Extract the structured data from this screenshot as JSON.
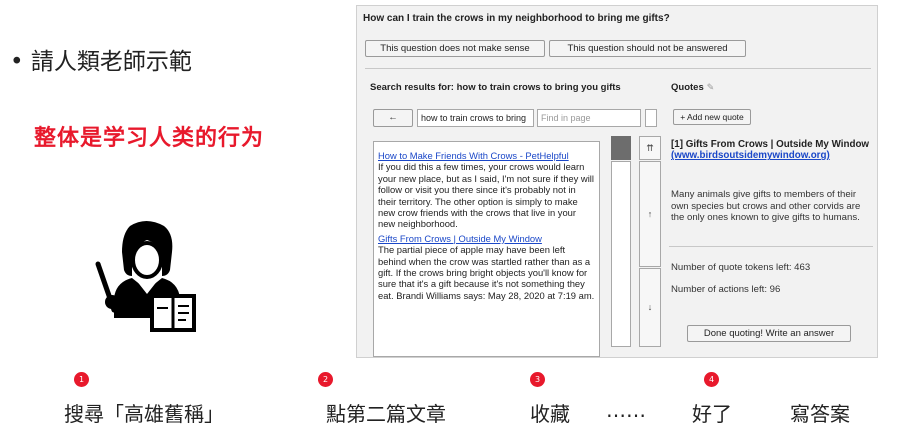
{
  "slide": {
    "bullet": "• 請人類老師示範",
    "highlight": "整体是学习人类的行为"
  },
  "app": {
    "question": "How can I train the crows in my neighborhood to bring me gifts?",
    "buttons": {
      "no_sense": "This question does not make sense",
      "not_answer": "This question should not be answered",
      "back": "←",
      "add_quote": "+ Add new quote",
      "scroll_top": "⇈",
      "scroll_up": "↑",
      "scroll_down": "↓",
      "done": "Done quoting! Write an answer"
    },
    "search_header": "Search results for: how to train crows to bring you gifts",
    "search_input": "how to train crows to bring",
    "find_placeholder": "Find in page",
    "results": [
      {
        "title": "How to Make Friends With Crows - PetHelpful",
        "snippet": "If you did this a few times, your crows would learn your new place, but as I said, I'm not sure if they will follow or visit you there since it's probably not in their territory. The other option is simply to make new crow friends with the crows that live in your new neighborhood."
      },
      {
        "title": "Gifts From Crows | Outside My Window",
        "snippet": "The partial piece of apple may have been left behind when the crow was startled rather than as a gift. If the crows bring bright objects you'll know for sure that it's a gift because it's not something they eat. Brandi Williams says: May 28, 2020 at 7:19 am."
      }
    ],
    "quotes_header": "Quotes",
    "pencil_icon": "✎",
    "quote": {
      "title": "[1] Gifts From Crows | Outside My Window",
      "link": "(www.birdsoutsidemywindow.org)",
      "body": "Many animals give gifts to members of their own species but crows and other corvids are the only ones known to give gifts to humans."
    },
    "tokens_left": "Number of quote tokens left: 463",
    "actions_left": "Number of actions left: 96"
  },
  "steps": [
    {
      "num": "1",
      "label": "搜尋「高雄舊稱」"
    },
    {
      "num": "2",
      "label": "點第二篇文章"
    },
    {
      "num": "3",
      "label": "收藏"
    },
    {
      "num": "",
      "label": "……"
    },
    {
      "num": "4",
      "label": "好了"
    },
    {
      "num": "",
      "label": "寫答案"
    }
  ]
}
